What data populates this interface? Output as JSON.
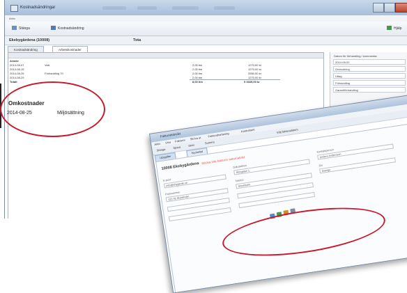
{
  "back_window": {
    "title": "Kostnadsändringar",
    "menu": "Arkiv",
    "toolbar": {
      "left_label": "Stänga",
      "mid_label": "Kostnadsändring",
      "right_label": "Hjälp"
    },
    "record": {
      "name": "Ekebygärdena (10008)",
      "total_label": "Tota"
    },
    "tabs": [
      "Kostnadsändring",
      "Arbetskostnader"
    ],
    "grid": {
      "section_label": "Arbete",
      "rows": [
        {
          "date": "2014-08-07",
          "text": "Vatr",
          "qty": "2,00 tim",
          "amount": "1270,00 kr"
        },
        {
          "date": "2014-08-15",
          "text": "",
          "qty": "2,00 tim",
          "amount": "1270,00 kr"
        },
        {
          "date": "2014-08-25",
          "text": "Förhandling 70",
          "qty": "2,00 tim",
          "amount": "2550,00 kr"
        },
        {
          "date": "2014-08-29",
          "text": "",
          "qty": "2,00 tim",
          "amount": "1270,00 kr"
        }
      ],
      "total_row": {
        "label": "Totalt",
        "qty": "8,00 tim",
        "amount": "5 3335,00 kr"
      }
    },
    "side_panel": {
      "heading": "Datum för förhandling / kommentar",
      "date_value": "2014-08-02",
      "items": [
        "Ombudning",
        "Uttag",
        "Förhandling",
        "Garantiförhandling"
      ]
    }
  },
  "callout": {
    "title": "Omkostnader",
    "date": "2014-08-25",
    "value": "Miljösättning"
  },
  "front_window": {
    "title": "Fakturahänsikt",
    "menu": [
      "Arkiv",
      "Visa",
      "Fakturor",
      "Skriva ut",
      "Fakturahantering",
      "Kontrahent"
    ],
    "toolbar": [
      "Stänga",
      "Spara",
      "Skriv",
      "Summa",
      "Välj fakturadatum"
    ],
    "tabs": [
      "Uppgifter",
      "Nyckeltal"
    ],
    "record_id": "10008",
    "record_name": "Ekebygärdena",
    "warning": "Skicka inte fakturor automatiskt",
    "fields": [
      {
        "label": "Kontaktperson",
        "value": "Anders Andersson"
      },
      {
        "label": "E-post",
        "value": "info@ebygarde.se"
      },
      {
        "label": "Gatuadress",
        "value": "Storgatan 1"
      },
      {
        "label": "Telefon",
        "value": "Stockholm"
      },
      {
        "label": "Postnummer",
        "value": "123 45 Stockholm"
      },
      {
        "label": "Ort",
        "value": "Sverige"
      }
    ]
  },
  "colors": {
    "accent_red": "#c8192c",
    "title_blue": "#a7bedb"
  }
}
